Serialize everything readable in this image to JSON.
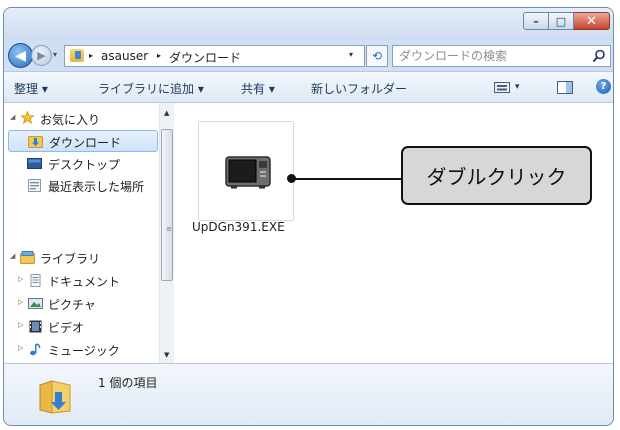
{
  "window": {
    "controls": {
      "minimize": "–",
      "maximize": "□",
      "close": "✕"
    }
  },
  "nav": {
    "back_icon": "back-arrow-icon",
    "forward_icon": "forward-arrow-icon"
  },
  "address": {
    "sep": "▸",
    "crumbs": [
      "asauser",
      "ダウンロード"
    ],
    "dropdown": "▾",
    "refresh": "⟲"
  },
  "search": {
    "placeholder": "ダウンロードの検索"
  },
  "toolbar": {
    "organize": "整理 ▾",
    "include_library": "ライブラリに追加 ▾",
    "share": "共有 ▾",
    "new_folder": "新しいフォルダー",
    "view_menu": "▾",
    "help": "?"
  },
  "sidebar": {
    "items": [
      {
        "label": "お気に入り",
        "icon": "star-icon",
        "arrow": "◢"
      },
      {
        "label": "ダウンロード",
        "icon": "downloads-folder-icon",
        "selected": true
      },
      {
        "label": "デスクトップ",
        "icon": "desktop-icon"
      },
      {
        "label": "最近表示した場所",
        "icon": "recent-places-icon"
      },
      {
        "label": "ライブラリ",
        "icon": "libraries-icon",
        "arrow": "◢"
      },
      {
        "label": "ドキュメント",
        "icon": "documents-icon",
        "arrow": "▷"
      },
      {
        "label": "ピクチャ",
        "icon": "pictures-icon",
        "arrow": "▷"
      },
      {
        "label": "ビデオ",
        "icon": "videos-icon",
        "arrow": "▷"
      },
      {
        "label": "ミュージック",
        "icon": "music-icon",
        "arrow": "▷"
      }
    ],
    "scroll_up": "▲",
    "scroll_down": "▼",
    "grip": "≡"
  },
  "content": {
    "file": {
      "name": "UpDGn391.EXE",
      "icon": "microwave-exe-icon"
    },
    "callout": "ダブルクリック"
  },
  "details": {
    "count_text": "1 個の項目",
    "icon": "downloads-folder-icon"
  },
  "colors": {
    "accent": "#2a6cc0",
    "callout_bg": "#d7d7d7",
    "selection": "#cde3fb"
  }
}
